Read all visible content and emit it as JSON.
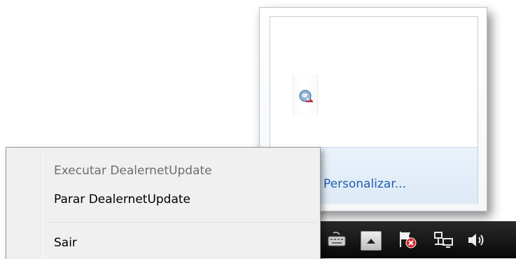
{
  "flyout": {
    "customize_label": "Personalizar..."
  },
  "tray_icons": [
    "globe-icon",
    "keyboard-icon",
    "show-hidden-icons-icon",
    "action-center-flag-icon",
    "network-icon",
    "volume-icon"
  ],
  "context_menu": {
    "items": [
      {
        "label": "Executar DealernetUpdate",
        "enabled": false
      },
      {
        "label": "Parar DealernetUpdate",
        "enabled": true
      },
      {
        "label": "Sair",
        "enabled": true
      }
    ]
  },
  "colors": {
    "link": "#1f5fb0",
    "disabled_text": "#6d6d6d",
    "menu_bg": "#f0f0f0",
    "taskbar": "#111111"
  }
}
